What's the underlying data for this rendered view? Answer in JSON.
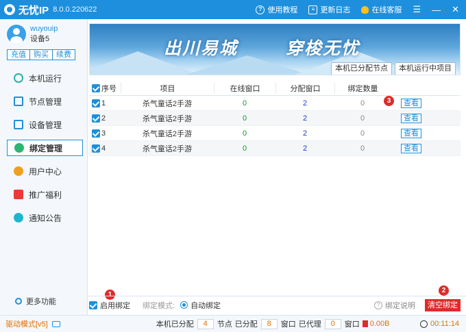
{
  "titlebar": {
    "app_name": "无忧IP",
    "version": "8.0.0.220622",
    "tutorial": "使用教程",
    "changelog": "更新日志",
    "support": "在线客服",
    "menu_glyph": "☰",
    "minimize_glyph": "—",
    "close_glyph": "✕"
  },
  "sidebar": {
    "username": "wuyouip",
    "device": "设备5",
    "buttons": [
      "充值",
      "购买",
      "续费"
    ],
    "items": [
      {
        "label": "本机运行",
        "icon": "play-icon"
      },
      {
        "label": "节点管理",
        "icon": "node-icon"
      },
      {
        "label": "设备管理",
        "icon": "device-icon"
      },
      {
        "label": "绑定管理",
        "icon": "bind-icon",
        "active": true
      },
      {
        "label": "用户中心",
        "icon": "user-icon"
      },
      {
        "label": "推广福利",
        "icon": "gift-icon"
      },
      {
        "label": "通知公告",
        "icon": "notice-icon"
      }
    ],
    "more": "更多功能"
  },
  "banner": {
    "slogan1": "出川易城",
    "slogan2": "穿梭无忧",
    "tab1": "本机已分配节点",
    "tab2": "本机运行中项目"
  },
  "table": {
    "headers": [
      "序号",
      "项目",
      "在线窗口",
      "分配窗口",
      "绑定数量"
    ],
    "rows": [
      {
        "no": "1",
        "project": "杀气童话2手游",
        "online": "0",
        "assigned": "2",
        "bound": "0",
        "action": "查看"
      },
      {
        "no": "2",
        "project": "杀气童话2手游",
        "online": "0",
        "assigned": "2",
        "bound": "0",
        "action": "查看"
      },
      {
        "no": "3",
        "project": "杀气童话2手游",
        "online": "0",
        "assigned": "2",
        "bound": "0",
        "action": "查看"
      },
      {
        "no": "4",
        "project": "杀气童话2手游",
        "online": "0",
        "assigned": "2",
        "bound": "0",
        "action": "查看"
      }
    ]
  },
  "badges": [
    "1",
    "2",
    "3"
  ],
  "bindbar": {
    "enable": "启用绑定",
    "mode_label": "绑定模式:",
    "mode_value": "自动绑定",
    "help": "绑定说明",
    "clear": "清空绑定"
  },
  "statusbar": {
    "driver": "驱动模式[v5]",
    "label_assigned": "本机已分配",
    "assigned_count": "4",
    "label_node": "节点",
    "label_assigned2": "已分配",
    "assigned2_count": "8",
    "label_window": "窗口",
    "label_proxied": "已代理",
    "proxied_count": "0",
    "label_window2": "窗口",
    "speed": "0.00B",
    "timer": "00:11:14"
  },
  "colors": {
    "accent": "#1e8fdc",
    "danger": "#e02b2b",
    "online_green": "#0a9a2a",
    "assigned_blue": "#1a3ad8",
    "status_orange": "#e07000"
  }
}
